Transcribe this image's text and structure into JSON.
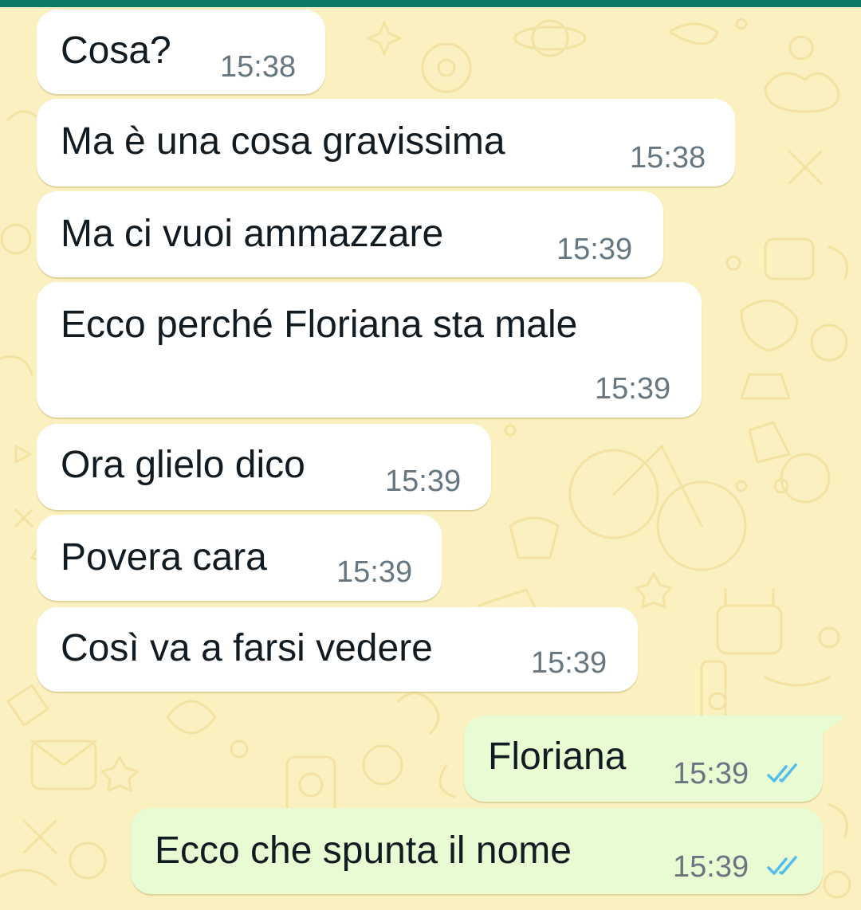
{
  "chat": {
    "colors": {
      "wallpaper": "#fbf0bf",
      "incoming_bubble": "#ffffff",
      "outgoing_bubble": "#e8fbd3",
      "read_ticks": "#53bdeb",
      "header_strip": "#0b7a64"
    },
    "messages": [
      {
        "direction": "incoming",
        "text": "Cosa?",
        "time": "15:38"
      },
      {
        "direction": "incoming",
        "text": "Ma è una cosa gravissima",
        "time": "15:38"
      },
      {
        "direction": "incoming",
        "text": "Ma ci vuoi ammazzare",
        "time": "15:39"
      },
      {
        "direction": "incoming",
        "text": "Ecco perché Floriana sta male",
        "time": "15:39"
      },
      {
        "direction": "incoming",
        "text": "Ora glielo dico",
        "time": "15:39"
      },
      {
        "direction": "incoming",
        "text": "Povera cara",
        "time": "15:39"
      },
      {
        "direction": "incoming",
        "text": "Così va a farsi vedere",
        "time": "15:39"
      },
      {
        "direction": "outgoing",
        "text": "Floriana",
        "time": "15:39",
        "status_icon": "double-check-read-icon"
      },
      {
        "direction": "outgoing",
        "text": "Ecco che spunta il nome",
        "time": "15:39",
        "status_icon": "double-check-read-icon"
      }
    ]
  }
}
